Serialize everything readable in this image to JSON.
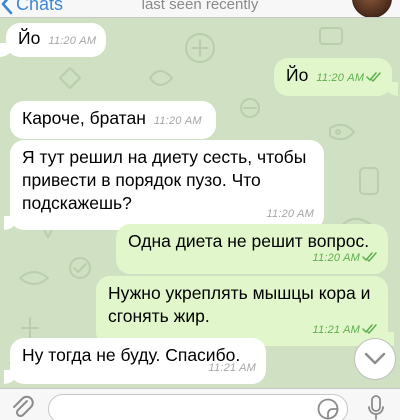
{
  "header": {
    "back_label": "Chats",
    "status": "last seen recently"
  },
  "messages": [
    {
      "direction": "in",
      "text": "Йо",
      "time": "11:20 AM"
    },
    {
      "direction": "out",
      "text": "Йо",
      "time": "11:20 AM",
      "read": true
    },
    {
      "direction": "in",
      "text": "Кароче, братан",
      "time": "11:20 AM"
    },
    {
      "direction": "in",
      "text": "Я тут решил на диету сесть, чтобы привести в порядок пузо. Что подскажешь?",
      "time": "11:20 AM"
    },
    {
      "direction": "out",
      "text": "Одна диета не решит вопрос.",
      "time": "11:20 AM",
      "read": true
    },
    {
      "direction": "out",
      "text": "Нужно укреплять мышцы кора и сгонять жир.",
      "time": "11:21 AM",
      "read": true
    },
    {
      "direction": "in",
      "text": "Ну тогда не буду. Спасибо.",
      "time": "11:21 AM"
    }
  ],
  "input": {
    "placeholder": "",
    "value": ""
  },
  "icons": {
    "back": "chevron-left-icon",
    "attach": "paperclip-icon",
    "sticker": "sticker-icon",
    "mic": "microphone-icon",
    "scroll": "chevron-down-icon",
    "read_status": "double-check-icon"
  },
  "colors": {
    "accent": "#3c88d7",
    "incoming_bubble": "#ffffff",
    "outgoing_bubble": "#e1f7cb",
    "outgoing_time": "#5fae4e",
    "incoming_time": "#a6a6a6",
    "chat_background": "#cfe0c3"
  }
}
